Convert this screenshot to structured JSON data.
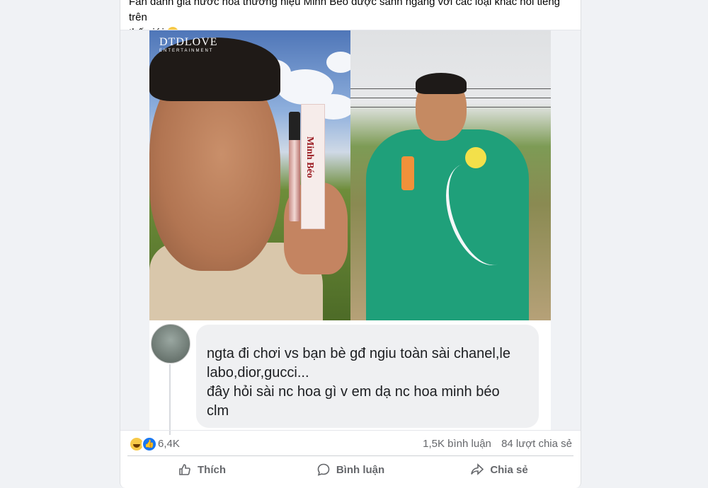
{
  "post": {
    "caption_line1": "Fan đánh giá nước hoa thương hiệu Minh Béo được sánh ngang với các loại khác nổi tiếng trên",
    "caption_line2": "thế giới"
  },
  "media": {
    "watermark_main": "DTDLOVE",
    "watermark_sub": "ENTERTAINMENT",
    "product_label": "Minh Béo"
  },
  "comment": {
    "line1": "ngta đi chơi vs bạn bè gđ ngiu  toàn sài chanel,le",
    "line2": "labo,dior,gucci...",
    "line3": "đây hỏi sài nc hoa gì v em dạ nc hoa minh béo",
    "line4": "clm"
  },
  "reactions": {
    "count": "6,4K",
    "comments": "1,5K bình luận",
    "shares": "84 lượt chia sẻ"
  },
  "actions": {
    "like": "Thích",
    "comment": "Bình luận",
    "share": "Chia sẻ"
  },
  "colors": {
    "like_blue": "#1877f2",
    "haha_yellow": "#f7c948",
    "ao_dai_green": "#1fa07a"
  }
}
